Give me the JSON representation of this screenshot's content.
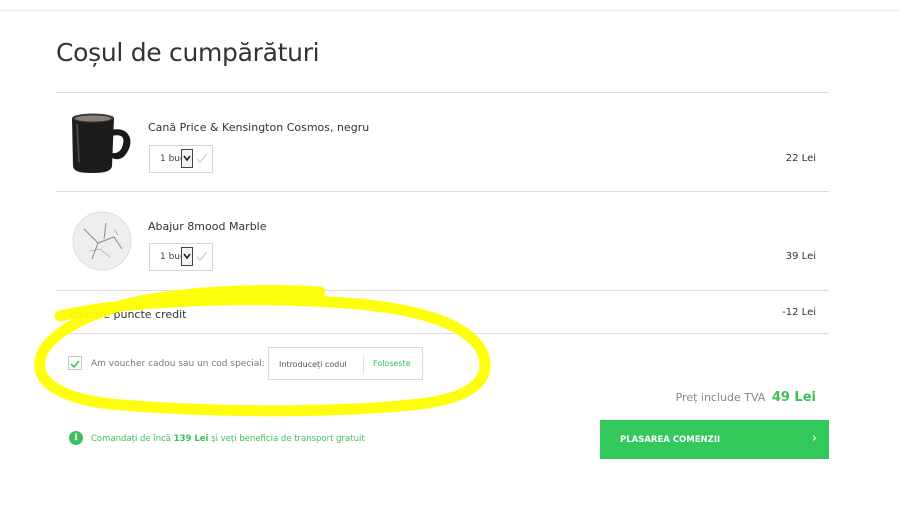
{
  "page_title": "Coșul de cumpărături",
  "items": [
    {
      "name": "Cană Price & Kensington Cosmos, negru",
      "quantity": "1 buc",
      "price": "22 Lei",
      "image": "black-mug"
    },
    {
      "name": "Abajur 8mood Marble",
      "quantity": "1 buc",
      "price": "39 Lei",
      "image": "marble-lampshade"
    }
  ],
  "credit": {
    "label": "Valoare puncte credit",
    "value": "-12 Lei"
  },
  "voucher": {
    "checkbox_label": "Am voucher cadou sau un cod special:",
    "checked": true,
    "input_placeholder": "Introduceți codul",
    "apply_label": "Foloseste"
  },
  "total": {
    "label": "Preț include TVA",
    "amount": "49 Lei"
  },
  "shipping_notice": {
    "before": "Comandați de încă ",
    "amount": "139 Lei",
    "after": " și veți beneficia de transport gratuit"
  },
  "order_button": {
    "label": "PLASAREA COMENZII",
    "icon": "chevron-right"
  },
  "colors": {
    "accent_green": "#33c85a",
    "highlight": "#ffff00"
  }
}
